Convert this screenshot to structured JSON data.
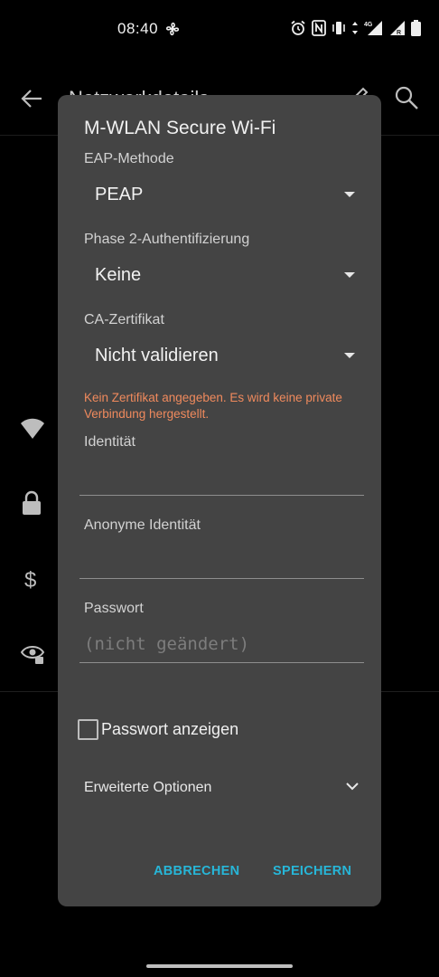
{
  "status_bar": {
    "time": "08:40",
    "icons": [
      "fan-icon",
      "alarm-icon",
      "nfc-icon",
      "vibrate-icon",
      "data-arrows-icon",
      "signal-4g-icon",
      "signal-r-icon",
      "battery-icon"
    ],
    "network_badge": "4G",
    "roaming_badge": "R"
  },
  "background": {
    "title": "Netzwerkdetails"
  },
  "dialog": {
    "title": "M-WLAN Secure Wi-Fi",
    "eap": {
      "label": "EAP-Methode",
      "value": "PEAP"
    },
    "phase2": {
      "label": "Phase 2-Authentifizierung",
      "value": "Keine"
    },
    "ca": {
      "label": "CA-Zertifikat",
      "value": "Nicht validieren"
    },
    "warning": "Kein Zertifikat angegeben. Es wird keine private Verbindung hergestellt.",
    "identity": {
      "label": "Identität",
      "value": ""
    },
    "anon_identity": {
      "label": "Anonyme Identität",
      "value": ""
    },
    "password": {
      "label": "Passwort",
      "placeholder": "(nicht geändert)"
    },
    "show_password": {
      "label": "Passwort anzeigen",
      "checked": false
    },
    "advanced": {
      "label": "Erweiterte Optionen"
    },
    "cancel_label": "ABBRECHEN",
    "save_label": "SPEICHERN"
  },
  "colors": {
    "dialog_bg": "#444444",
    "accent": "#27b6d8",
    "warning": "#f08a5d"
  }
}
